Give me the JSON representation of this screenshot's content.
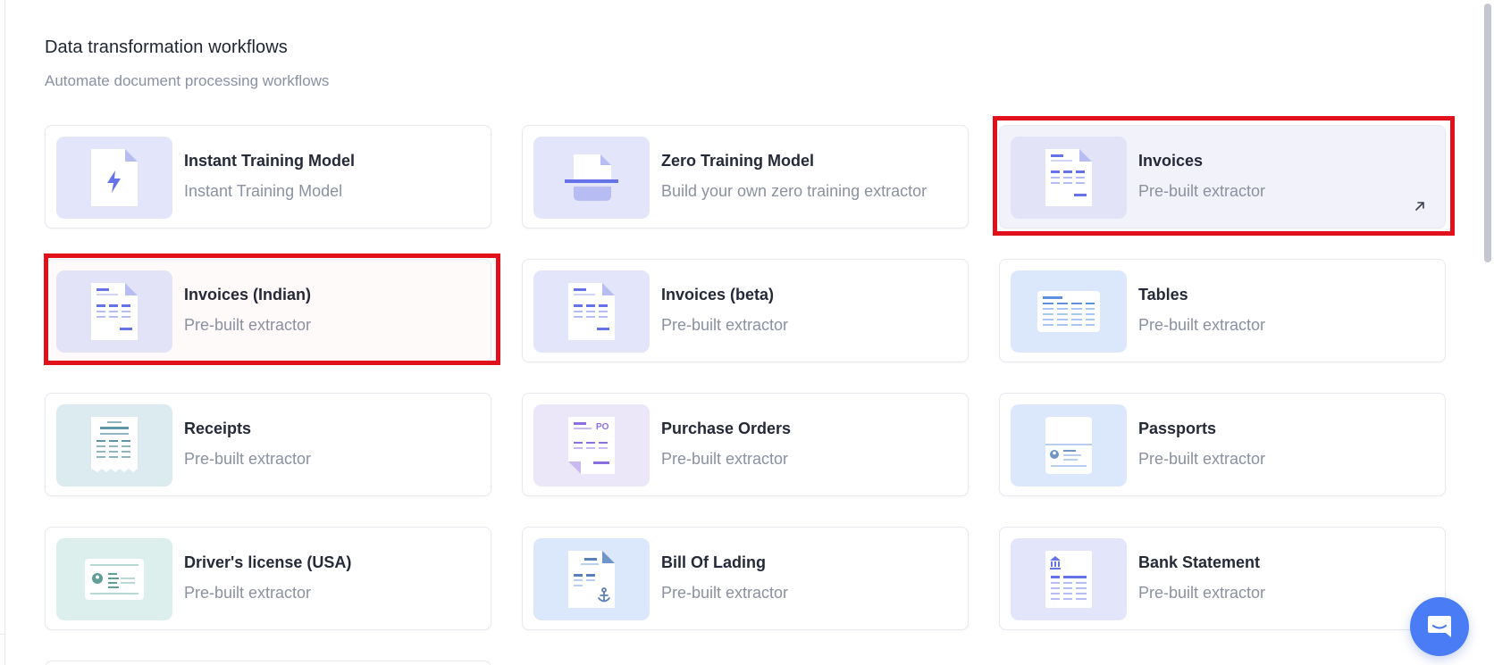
{
  "section": {
    "title": "Data transformation workflows",
    "subtitle": "Automate document processing workflows"
  },
  "cards": [
    {
      "title": "Instant Training Model",
      "subtitle": "Instant Training Model",
      "icon": "lightning-document-icon",
      "thumb_color": "#e3e6fb"
    },
    {
      "title": "Zero Training Model",
      "subtitle": "Build your own zero training extractor",
      "icon": "scan-document-icon",
      "thumb_color": "#e3e6fb"
    },
    {
      "title": "Invoices",
      "subtitle": "Pre-built extractor",
      "icon": "invoice-document-icon",
      "thumb_color": "#e3e3f8",
      "state": "hovered",
      "highlighted": true
    },
    {
      "title": "Invoices (Indian)",
      "subtitle": "Pre-built extractor",
      "icon": "invoice-document-icon",
      "thumb_color": "#e3e3f8",
      "highlighted": true
    },
    {
      "title": "Invoices (beta)",
      "subtitle": "Pre-built extractor",
      "icon": "invoice-document-icon",
      "thumb_color": "#e3e6fb"
    },
    {
      "title": "Tables",
      "subtitle": "Pre-built extractor",
      "icon": "table-document-icon",
      "thumb_color": "#dbe8fb"
    },
    {
      "title": "Receipts",
      "subtitle": "Pre-built extractor",
      "icon": "receipt-icon",
      "thumb_color": "#dcebef"
    },
    {
      "title": "Purchase Orders",
      "subtitle": "Pre-built extractor",
      "icon": "purchase-order-icon",
      "thumb_color": "#ece7f8",
      "badge_text": "PO"
    },
    {
      "title": "Passports",
      "subtitle": "Pre-built extractor",
      "icon": "passport-icon",
      "thumb_color": "#dbe8fb"
    },
    {
      "title": "Driver's license (USA)",
      "subtitle": "Pre-built extractor",
      "icon": "id-card-icon",
      "thumb_color": "#dcefec"
    },
    {
      "title": "Bill Of Lading",
      "subtitle": "Pre-built extractor",
      "icon": "anchor-document-icon",
      "thumb_color": "#dbe8fb"
    },
    {
      "title": "Bank Statement",
      "subtitle": "Pre-built extractor",
      "icon": "bank-document-icon",
      "thumb_color": "#e3e6fb"
    }
  ],
  "colors": {
    "accent_indigo": "#6673e8",
    "highlight_red": "#e0111a",
    "chat_blue": "#4a7df5"
  },
  "chat": {
    "icon": "chat-bubble-icon"
  }
}
